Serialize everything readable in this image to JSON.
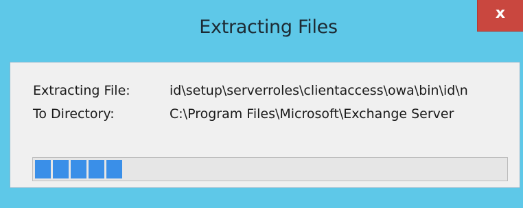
{
  "window": {
    "title": "Extracting Files",
    "close_label": "x"
  },
  "details": {
    "file_label": "Extracting File:",
    "file_value": "id\\setup\\serverroles\\clientaccess\\owa\\bin\\id\\n",
    "dir_label": "To Directory:",
    "dir_value": "C:\\Program Files\\Microsoft\\Exchange Server"
  },
  "progress": {
    "blocks_filled": 5,
    "fraction": 0.17
  },
  "colors": {
    "titlebar": "#5ec8e8",
    "close": "#c9473f",
    "progress": "#3a8fe8"
  }
}
